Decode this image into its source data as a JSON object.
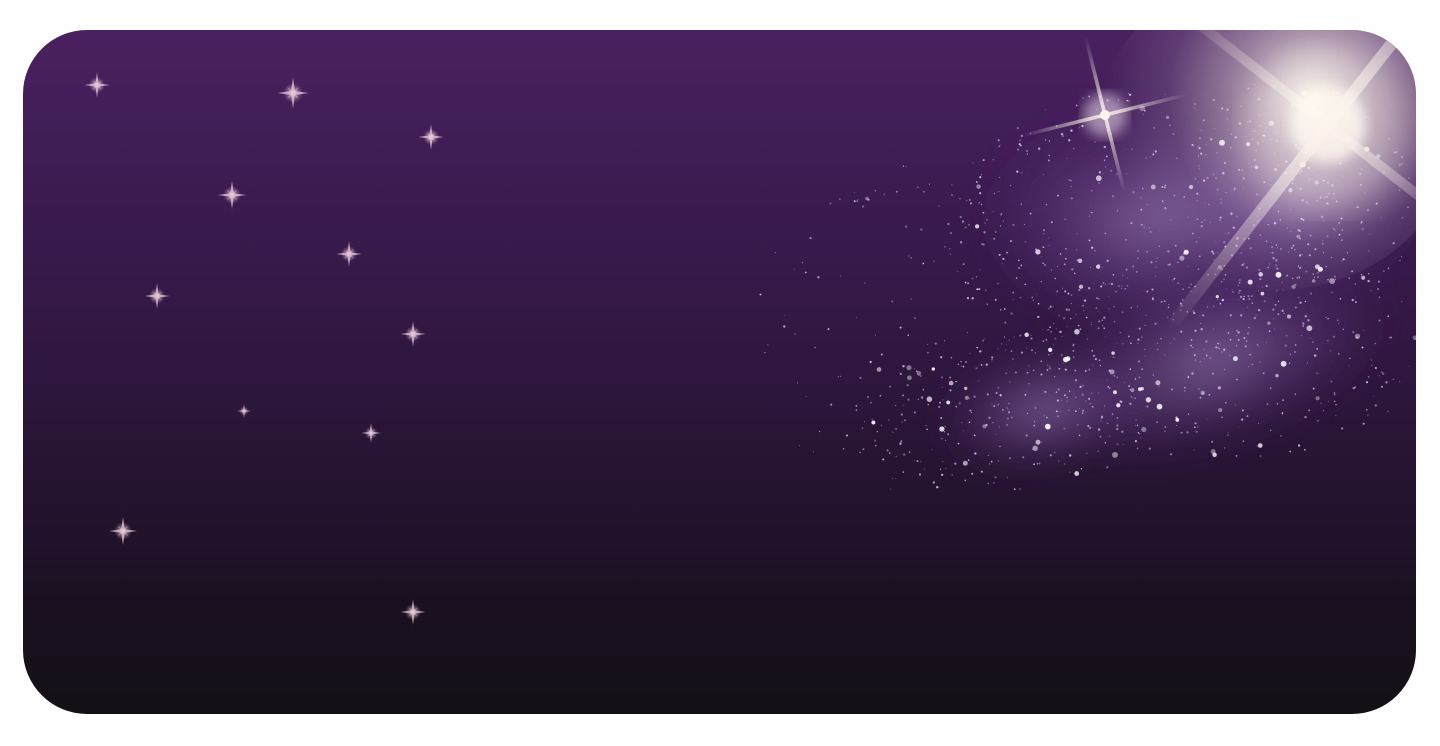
{
  "scene": {
    "background": {
      "top_color": "#4a2160",
      "bottom_color": "#141016",
      "page_color": "#ffffff"
    },
    "sparkle_color": "#e8c8d8",
    "dust_color": "#d8c8f0",
    "flare_color": "#fff6ea"
  }
}
